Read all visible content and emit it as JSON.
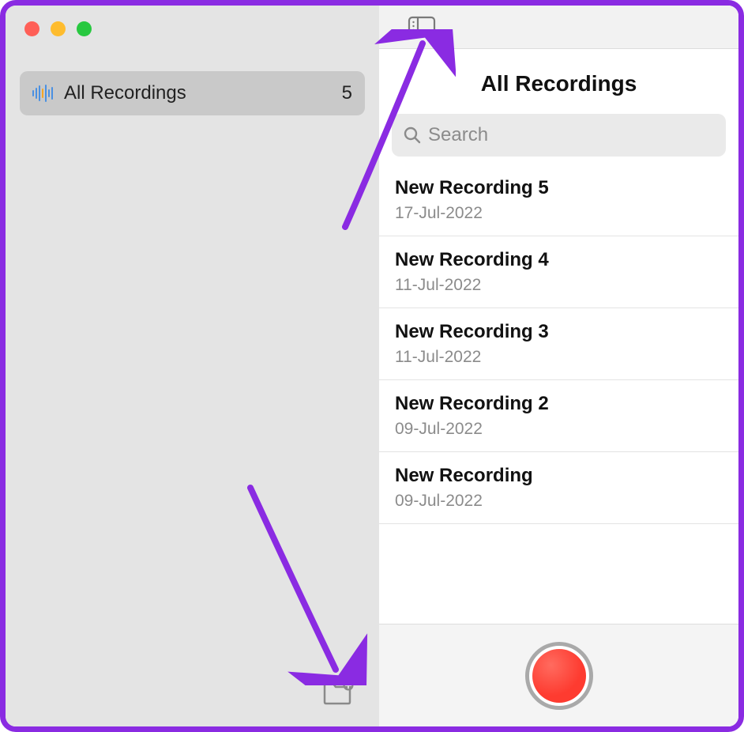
{
  "sidebar": {
    "folders": [
      {
        "label": "All Recordings",
        "count": "5",
        "icon": "waveform-icon"
      }
    ]
  },
  "main": {
    "title": "All Recordings",
    "search_placeholder": "Search",
    "recordings": [
      {
        "title": "New Recording 5",
        "date": "17-Jul-2022"
      },
      {
        "title": "New Recording 4",
        "date": "11-Jul-2022"
      },
      {
        "title": "New Recording 3",
        "date": "11-Jul-2022"
      },
      {
        "title": "New Recording 2",
        "date": "09-Jul-2022"
      },
      {
        "title": "New Recording",
        "date": "09-Jul-2022"
      }
    ]
  },
  "icons": {
    "toggle_sidebar": "toggle-sidebar-icon",
    "new_folder": "new-folder-icon",
    "search": "search-icon",
    "record": "record-icon"
  },
  "colors": {
    "accent_record": "#fe3b30",
    "annotation_arrow": "#8a2be2",
    "waveform_blue": "#4a90e2",
    "waveform_orange": "#f5a623"
  }
}
